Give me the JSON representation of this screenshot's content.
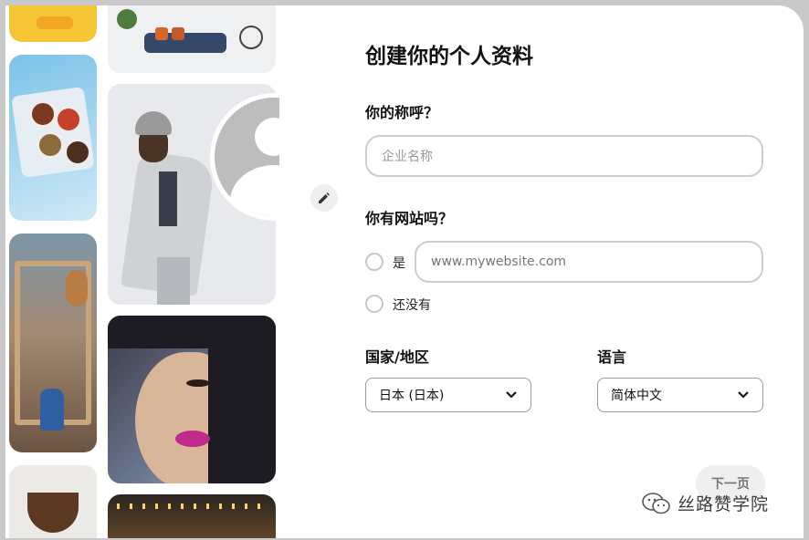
{
  "form": {
    "title": "创建你的个人资料",
    "name_label": "你的称呼？",
    "name_placeholder": "企业名称",
    "website_label": "你有网站吗？",
    "website_yes_label": "是",
    "website_placeholder": "www.mywebsite.com",
    "website_no_label": "还没有",
    "country_label": "国家/地区",
    "country_value": "日本 (日本)",
    "language_label": "语言",
    "language_value": "简体中文",
    "next_label": "下一页"
  },
  "watermark": {
    "text": "丝路赞学院",
    "icon": "wechat-icon"
  },
  "icons": {
    "edit": "pencil-icon",
    "dropdown": "chevron-down-icon",
    "avatar": "default-avatar-icon"
  },
  "colors": {
    "border": "#cdcdcd",
    "button_bg": "#efefef",
    "avatar_gray": "#bdbdbd"
  }
}
